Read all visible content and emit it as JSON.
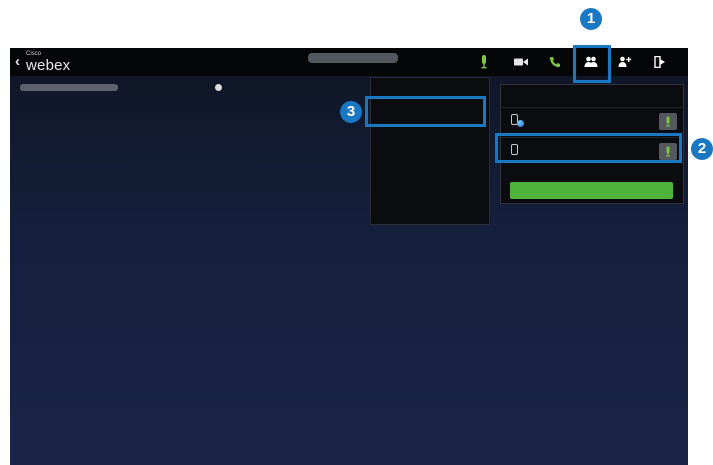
{
  "app": {
    "logo_small": "Cisco",
    "logo_large": "webex"
  },
  "toolbar": {
    "icons": [
      "microphone-icon",
      "video-camera-icon",
      "phone-icon",
      "participants-icon",
      "add-participant-icon",
      "leave-meeting-icon"
    ]
  },
  "callouts": {
    "one": "1",
    "two": "2",
    "three": "3"
  },
  "colors": {
    "callout": "#1a78c2",
    "accent_green": "#4db33a",
    "background": "#15203d"
  }
}
